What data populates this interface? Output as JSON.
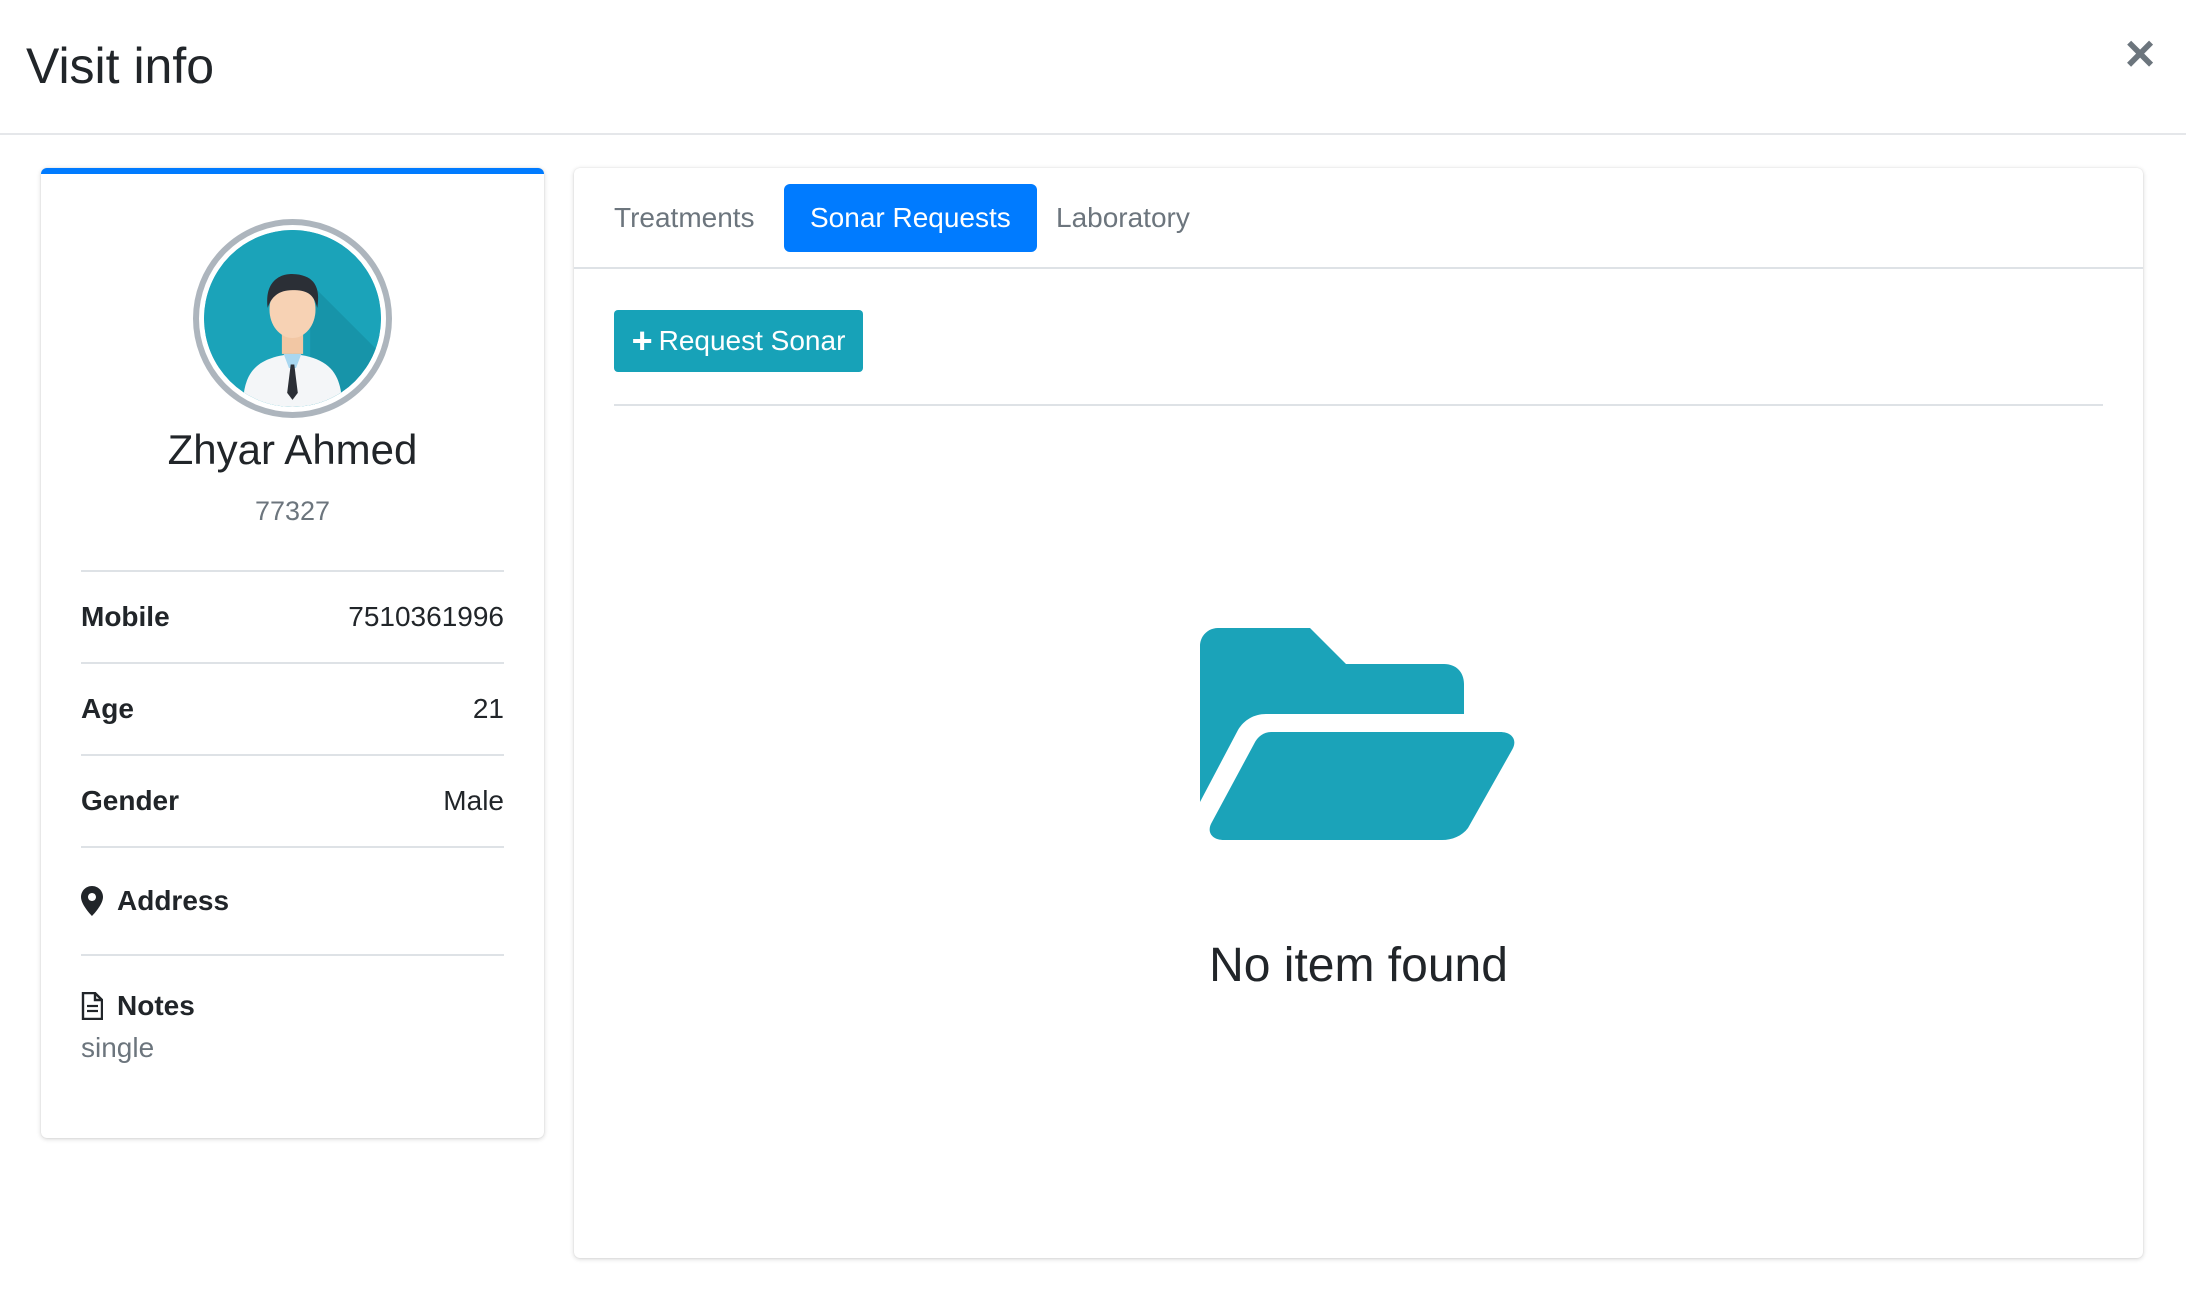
{
  "modal": {
    "title": "Visit info",
    "close_label": "×"
  },
  "patient": {
    "name": "Zhyar Ahmed",
    "id": "77327",
    "mobile_label": "Mobile",
    "mobile": "7510361996",
    "age_label": "Age",
    "age": "21",
    "gender_label": "Gender",
    "gender": "Male",
    "address_label": "Address",
    "notes_label": "Notes",
    "notes": "single"
  },
  "tabs": [
    {
      "label": "Treatments",
      "active": false
    },
    {
      "label": "Sonar Requests",
      "active": true
    },
    {
      "label": "Laboratory",
      "active": false
    }
  ],
  "actions": {
    "request_sonar_label": "Request Sonar"
  },
  "empty_state": {
    "message": "No item found",
    "icon": "folder-open-icon"
  },
  "colors": {
    "primary": "#007bff",
    "info": "#17a2b8",
    "folder": "#1ba3b9",
    "muted": "#6c757d"
  }
}
